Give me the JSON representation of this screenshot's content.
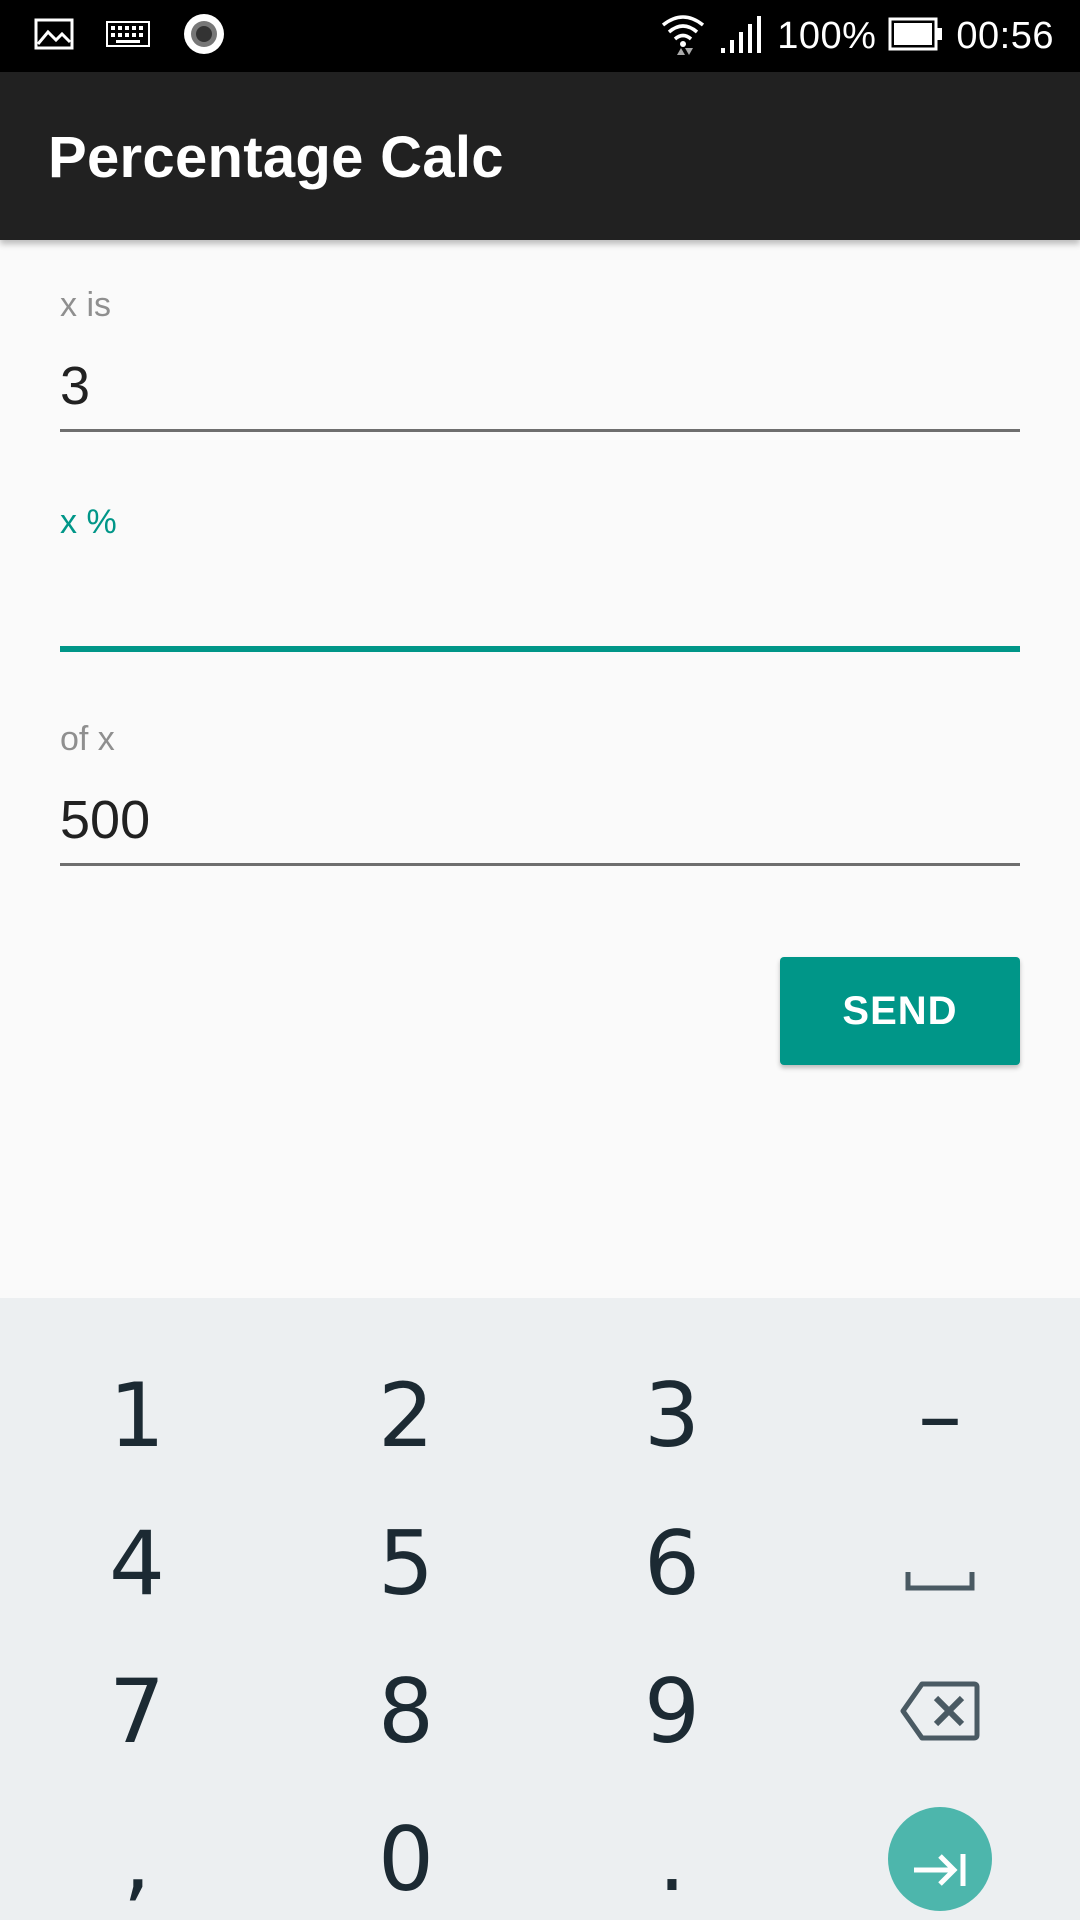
{
  "status_bar": {
    "left_icons": [
      "gallery-icon",
      "keyboard-icon",
      "record-icon"
    ],
    "right_icons": [
      "wifi-icon",
      "signal-icon",
      "battery-icon"
    ],
    "battery_text": "100%",
    "time": "00:56"
  },
  "app_bar": {
    "title": "Percentage Calc"
  },
  "form": {
    "field1": {
      "label": "x is",
      "value": "3"
    },
    "field2": {
      "label": "x %",
      "value": "",
      "focused": true
    },
    "field3": {
      "label": "of x",
      "value": "500"
    },
    "send_label": "SEND"
  },
  "keyboard": {
    "keys": [
      "1",
      "2",
      "3",
      "–",
      "4",
      "5",
      "6",
      "7",
      "8",
      "9",
      ",",
      "0",
      "."
    ],
    "special": [
      "space-icon",
      "backspace-icon",
      "next-field-icon"
    ]
  },
  "colors": {
    "accent": "#009688",
    "enter_key": "#4db6ac",
    "app_bar": "#212121",
    "keyboard_bg": "#eceff1"
  }
}
